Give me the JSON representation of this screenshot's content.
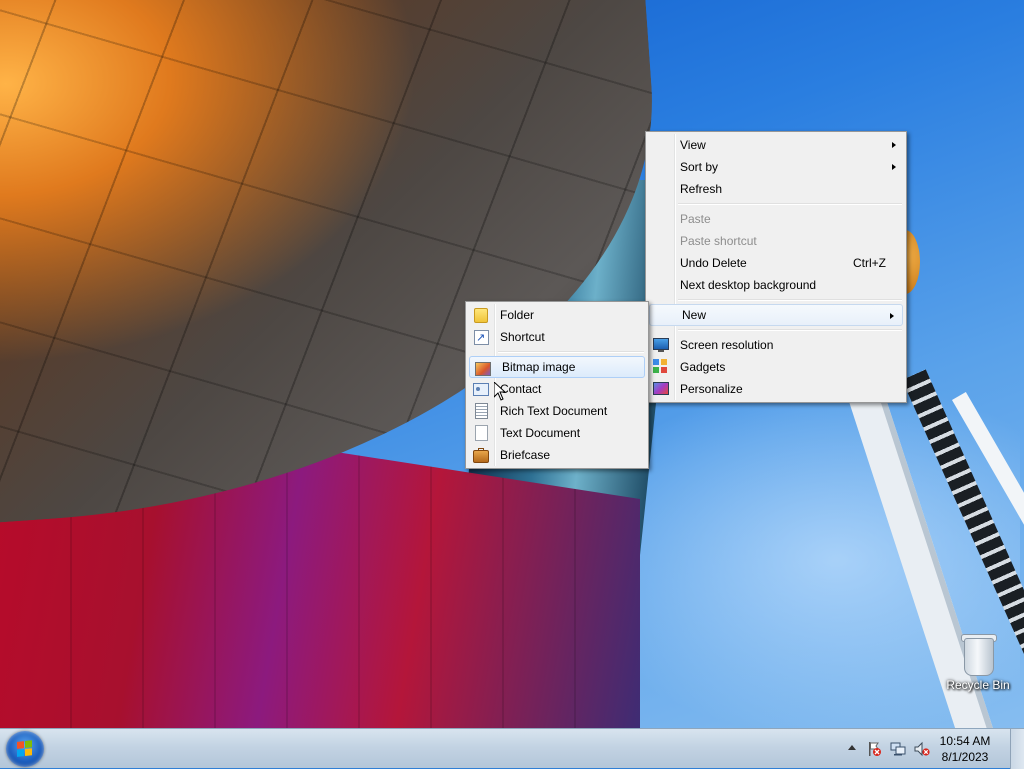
{
  "desktop": {
    "icons": [
      {
        "label": "Recycle Bin",
        "icon": "recycle-bin-icon"
      }
    ]
  },
  "context_menu": {
    "groups": [
      [
        {
          "label": "View",
          "submenu": true
        },
        {
          "label": "Sort by",
          "submenu": true
        },
        {
          "label": "Refresh"
        }
      ],
      [
        {
          "label": "Paste",
          "disabled": true
        },
        {
          "label": "Paste shortcut",
          "disabled": true
        },
        {
          "label": "Undo Delete",
          "shortcut": "Ctrl+Z"
        },
        {
          "label": "Next desktop background"
        }
      ],
      [
        {
          "label": "New",
          "submenu": true,
          "highlighted": true
        }
      ],
      [
        {
          "label": "Screen resolution",
          "icon": "screen-resolution-icon"
        },
        {
          "label": "Gadgets",
          "icon": "gadgets-icon"
        },
        {
          "label": "Personalize",
          "icon": "personalize-icon"
        }
      ]
    ]
  },
  "new_submenu": {
    "items": [
      {
        "label": "Folder",
        "icon": "folder-icon"
      },
      {
        "label": "Shortcut",
        "icon": "shortcut-icon"
      },
      {
        "label": "Bitmap image",
        "icon": "bitmap-image-icon",
        "highlighted": true
      },
      {
        "label": "Contact",
        "icon": "contact-icon"
      },
      {
        "label": "Rich Text Document",
        "icon": "rich-text-document-icon"
      },
      {
        "label": "Text Document",
        "icon": "text-document-icon"
      },
      {
        "label": "Briefcase",
        "icon": "briefcase-icon"
      }
    ]
  },
  "taskbar": {
    "start_icon": "windows-start-icon",
    "tray_icons": [
      "show-hidden-icons-icon",
      "action-center-flag-icon",
      "network-icon",
      "volume-muted-icon"
    ],
    "clock": {
      "time": "10:54 AM",
      "date": "8/1/2023"
    }
  },
  "colors": {
    "menu_bg": "#f0f0f0",
    "highlight_border": "#aecff7",
    "disabled_text": "#8d8d8d",
    "taskbar": "#c3d3e3"
  }
}
